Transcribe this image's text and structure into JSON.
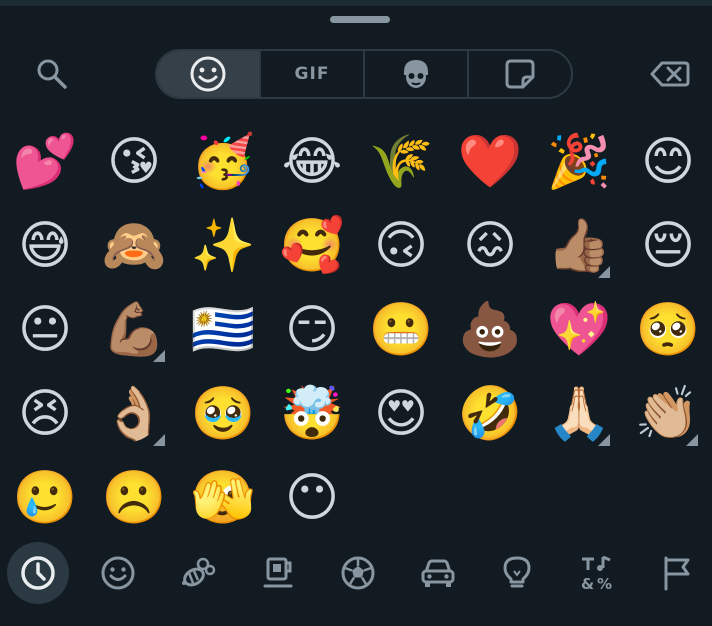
{
  "header": {
    "gif_label": "GIF"
  },
  "emojis": [
    "💕",
    "😘",
    "🥳",
    "😂",
    "🌾",
    "❤️",
    "🎉",
    "😊",
    "😅",
    "🙈",
    "✨",
    "🥰",
    "🙃",
    "😖",
    "👍🏽",
    "😔",
    "😐",
    "💪🏽",
    "🇺🇾",
    "😏",
    "😬",
    "💩",
    "💖",
    "🥺",
    "😣",
    "👌🏼",
    "🥹",
    "🤯",
    "😍",
    "🤣",
    "🙏🏻",
    "👏🏼",
    "🥲",
    "☹️",
    "🫣",
    "😶"
  ],
  "colors": {
    "background": "#121b22",
    "icon": "#8796a0",
    "active_icon": "#e9edef",
    "active_bg": "#364048"
  }
}
